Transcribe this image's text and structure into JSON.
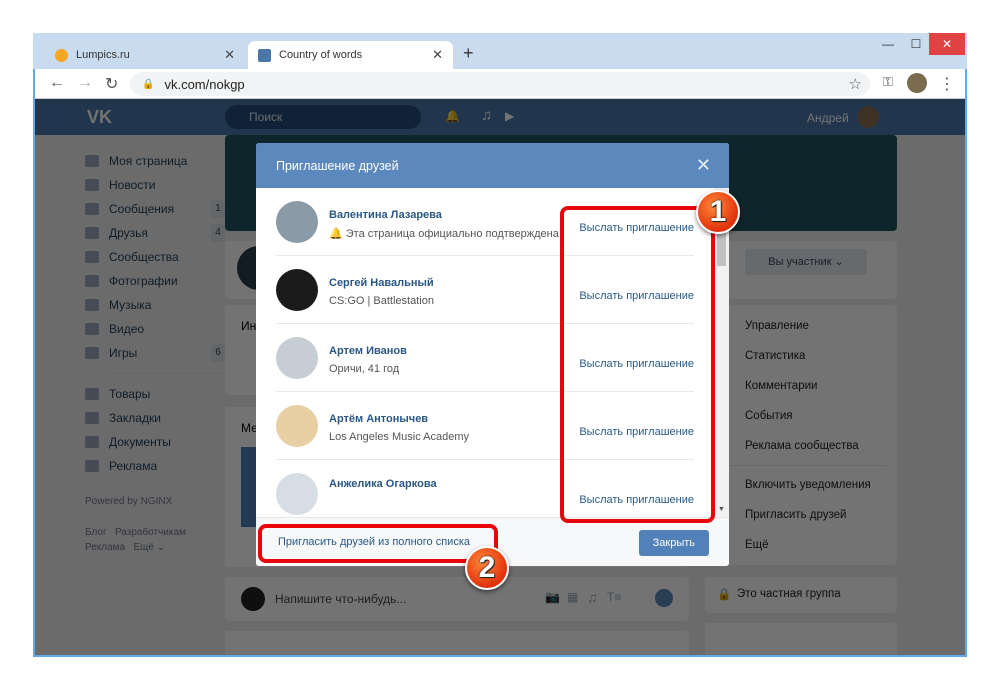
{
  "browser": {
    "tabs": [
      {
        "title": "Lumpics.ru",
        "favicon_color": "#f5a623"
      },
      {
        "title": "Country of words",
        "favicon_color": "#4a76a8"
      }
    ],
    "url": "vk.com/nokgp"
  },
  "vk": {
    "search_placeholder": "Поиск",
    "user_name": "Андрей",
    "sidebar": [
      {
        "label": "Моя страница"
      },
      {
        "label": "Новости"
      },
      {
        "label": "Сообщения",
        "count": "1"
      },
      {
        "label": "Друзья",
        "count": "4"
      },
      {
        "label": "Сообщества"
      },
      {
        "label": "Фотографии"
      },
      {
        "label": "Музыка"
      },
      {
        "label": "Видео"
      },
      {
        "label": "Игры",
        "count": "6"
      }
    ],
    "sidebar2": [
      {
        "label": "Товары"
      },
      {
        "label": "Закладки"
      },
      {
        "label": "Документы"
      },
      {
        "label": "Реклама"
      }
    ],
    "footer": {
      "powered": "Powered by NGINX",
      "blog": "Блог",
      "dev": "Разработчикам",
      "ads": "Реклама",
      "more": "Ещё"
    },
    "member_button": "Вы участник",
    "right_menu": [
      "Управление",
      "Статистика",
      "Комментарии",
      "События",
      "Реклама сообщества"
    ],
    "right_menu2": [
      "Включить уведомления",
      "Пригласить друзей",
      "Ещё"
    ],
    "private_group": "Это частная группа",
    "post_placeholder": "Напишите что-нибудь...",
    "tab_partial": "Ин",
    "block_partial": "Ме"
  },
  "modal": {
    "title": "Приглашение друзей",
    "friends": [
      {
        "name": "Валентина Лазарева",
        "sub": "Эта страница официально подтверждена",
        "verified": true,
        "invite": "Выслать приглашение",
        "avatar": "#8a9aa6"
      },
      {
        "name": "Сергей Навальный",
        "sub": "CS:GO | Battlestation",
        "invite": "Выслать приглашение",
        "avatar": "#1b1b1b"
      },
      {
        "name": "Артем Иванов",
        "sub": "Оричи, 41 год",
        "invite": "Выслать приглашение",
        "avatar": "#c7cdd4"
      },
      {
        "name": "Артём Антонычев",
        "sub": "Los Angeles Music Academy",
        "invite": "Выслать приглашение",
        "avatar": "#e8cfa4"
      },
      {
        "name": "Анжелика Огаркова",
        "sub": "",
        "invite": "Выслать приглашение",
        "avatar": "#d7dde4"
      }
    ],
    "invite_all": "Пригласить друзей из полного списка",
    "close": "Закрыть"
  },
  "annotations": {
    "badge1": "1",
    "badge2": "2",
    "highlight_color": "#e8050b"
  }
}
